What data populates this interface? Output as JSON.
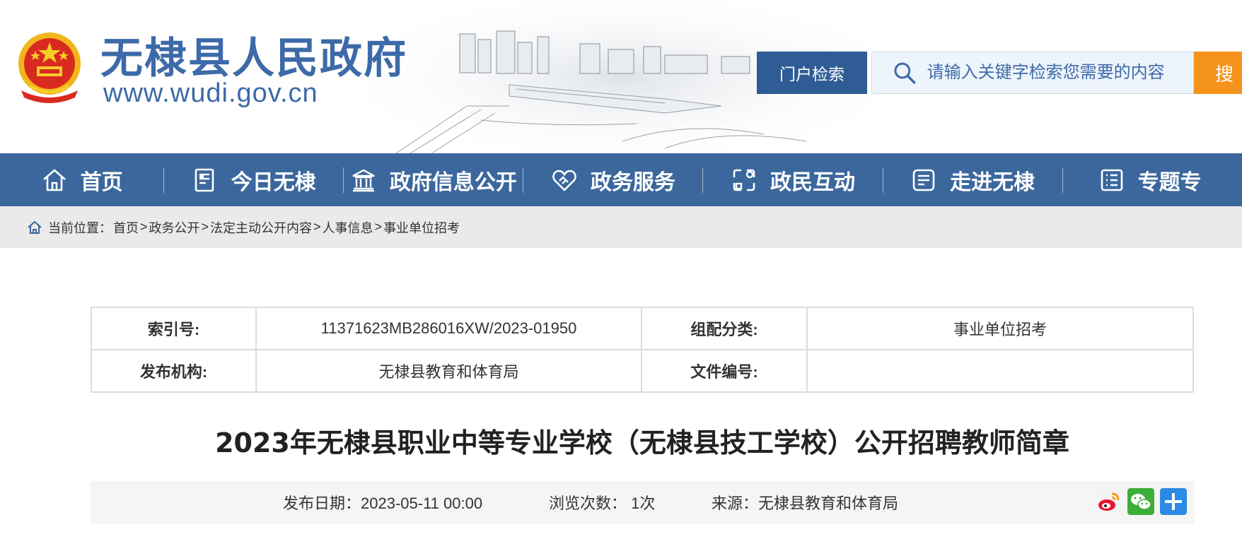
{
  "header": {
    "site_title": "无棣县人民政府",
    "site_url": "www.wudi.gov.cn",
    "search_scope": "门户检索",
    "search_placeholder": "请输入关键字检索您需要的内容",
    "search_submit": "搜"
  },
  "nav": {
    "items": [
      {
        "label": "首页",
        "icon": "home-icon"
      },
      {
        "label": "今日无棣",
        "icon": "document-icon"
      },
      {
        "label": "政府信息公开",
        "icon": "building-icon"
      },
      {
        "label": "政务服务",
        "icon": "heart-hand-icon"
      },
      {
        "label": "政民互动",
        "icon": "interaction-icon"
      },
      {
        "label": "走进无棣",
        "icon": "card-icon"
      },
      {
        "label": "专题专",
        "icon": "list-icon"
      }
    ]
  },
  "breadcrumb": {
    "prefix": "当前位置：",
    "items": [
      "首页",
      "政务公开",
      "法定主动公开内容",
      "人事信息",
      "事业单位招考"
    ],
    "separator": ">"
  },
  "meta": {
    "index_label": "索引号:",
    "index_value": "11371623MB286016XW/2023-01950",
    "category_label": "组配分类:",
    "category_value": "事业单位招考",
    "publisher_label": "发布机构:",
    "publisher_value": "无棣县教育和体育局",
    "docno_label": "文件编号:",
    "docno_value": ""
  },
  "article": {
    "title": "2023年无棣县职业中等专业学校（无棣县技工学校）公开招聘教师简章",
    "date": "发布日期：2023-05-11 00:00",
    "views": "浏览次数： 1次",
    "source": "来源：无棣县教育和体育局"
  },
  "colors": {
    "brand_blue": "#3b679d",
    "search_orange": "#f5931c",
    "title_blue": "#3d6aa8"
  },
  "share": [
    "weibo-icon",
    "wechat-icon",
    "more-share-icon"
  ]
}
